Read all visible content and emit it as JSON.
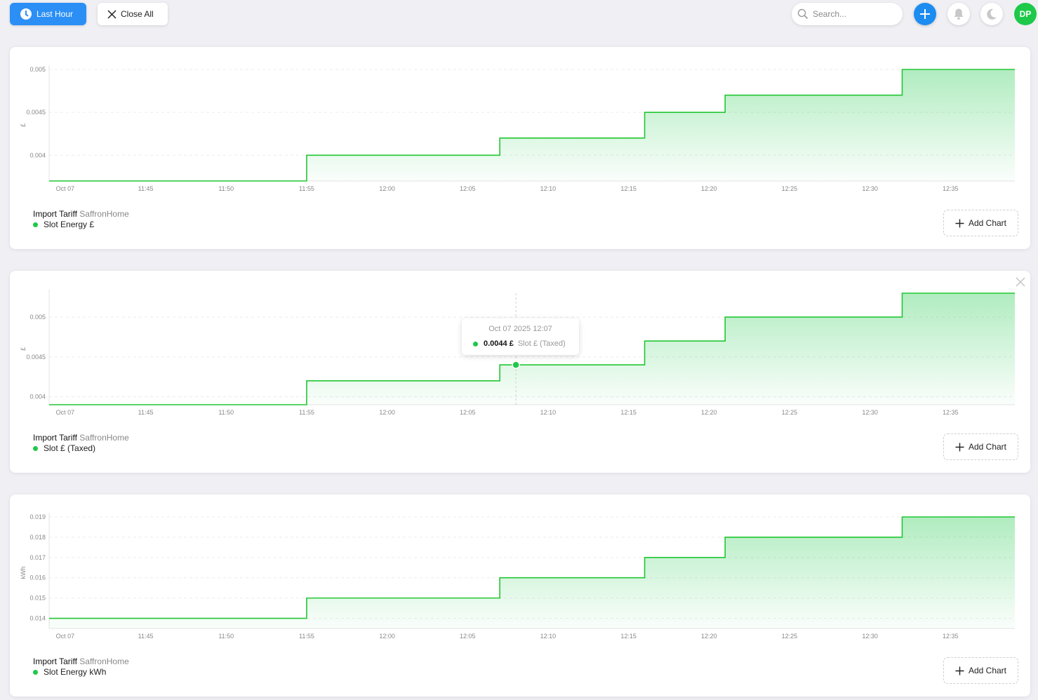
{
  "topbar": {
    "time_range_label": "Last Hour",
    "close_all_label": "Close All",
    "search_placeholder": "Search...",
    "avatar_initials": "DP"
  },
  "colors": {
    "accent": "#2b8ff5",
    "series": "#1ec94a",
    "line": "#21c732"
  },
  "icons": [
    "clock-icon",
    "close-icon",
    "search-icon",
    "plus-icon",
    "bell-icon",
    "moon-icon",
    "avatar"
  ],
  "panels": [
    {
      "entity": "Import Tariff",
      "device": "SaffronHome",
      "series_name": "Slot Energy £",
      "add_chart_label": "Add Chart",
      "closable": false
    },
    {
      "entity": "Import Tariff",
      "device": "SaffronHome",
      "series_name": "Slot £ (Taxed)",
      "add_chart_label": "Add Chart",
      "closable": true,
      "tooltip": {
        "time": "Oct 07 2025 12:07",
        "value": "0.0044 £",
        "series": "Slot £ (Taxed)"
      }
    },
    {
      "entity": "Import Tariff",
      "device": "SaffronHome",
      "series_name": "Slot Energy kWh",
      "add_chart_label": "Add Chart",
      "closable": false
    }
  ],
  "chart_data": [
    {
      "type": "area",
      "title": "",
      "xlabel": "",
      "ylabel": "£",
      "x_ticks": [
        "Oct 07",
        "11:45",
        "11:50",
        "11:55",
        "12:00",
        "12:05",
        "12:10",
        "12:15",
        "12:20",
        "12:25",
        "12:30",
        "12:35"
      ],
      "y_ticks": [
        "0.004",
        "0.0045",
        "0.005"
      ],
      "ylim": [
        0.0037,
        0.005
      ],
      "x_range": [
        "11:39",
        "12:39"
      ],
      "grid": true,
      "step": true,
      "series": [
        {
          "name": "Slot Energy £",
          "x": [
            "11:39",
            "11:55",
            "12:07",
            "12:16",
            "12:21",
            "12:32",
            "12:39"
          ],
          "values": [
            0.0037,
            0.004,
            0.0042,
            0.0045,
            0.0047,
            0.005,
            0.005
          ]
        }
      ]
    },
    {
      "type": "area",
      "title": "",
      "xlabel": "",
      "ylabel": "£",
      "x_ticks": [
        "Oct 07",
        "11:45",
        "11:50",
        "11:55",
        "12:00",
        "12:05",
        "12:10",
        "12:15",
        "12:20",
        "12:25",
        "12:30",
        "12:35"
      ],
      "y_ticks": [
        "0.004",
        "0.0045",
        "0.005"
      ],
      "ylim": [
        0.0039,
        0.0053
      ],
      "x_range": [
        "11:39",
        "12:39"
      ],
      "grid": true,
      "step": true,
      "series": [
        {
          "name": "Slot £ (Taxed)",
          "x": [
            "11:39",
            "11:55",
            "12:07",
            "12:16",
            "12:21",
            "12:32",
            "12:39"
          ],
          "values": [
            0.0039,
            0.0042,
            0.0044,
            0.0047,
            0.005,
            0.0053,
            0.0053
          ]
        }
      ]
    },
    {
      "type": "area",
      "title": "",
      "xlabel": "",
      "ylabel": "kWh",
      "x_ticks": [
        "Oct 07",
        "11:45",
        "11:50",
        "11:55",
        "12:00",
        "12:05",
        "12:10",
        "12:15",
        "12:20",
        "12:25",
        "12:30",
        "12:35"
      ],
      "y_ticks": [
        "0.014",
        "0.015",
        "0.016",
        "0.017",
        "0.018",
        "0.019"
      ],
      "ylim": [
        0.0135,
        0.019
      ],
      "x_range": [
        "11:39",
        "12:39"
      ],
      "grid": true,
      "step": true,
      "series": [
        {
          "name": "Slot Energy kWh",
          "x": [
            "11:39",
            "11:55",
            "12:07",
            "12:16",
            "12:21",
            "12:32",
            "12:39"
          ],
          "values": [
            0.014,
            0.015,
            0.016,
            0.017,
            0.018,
            0.019,
            0.019
          ]
        }
      ]
    }
  ]
}
